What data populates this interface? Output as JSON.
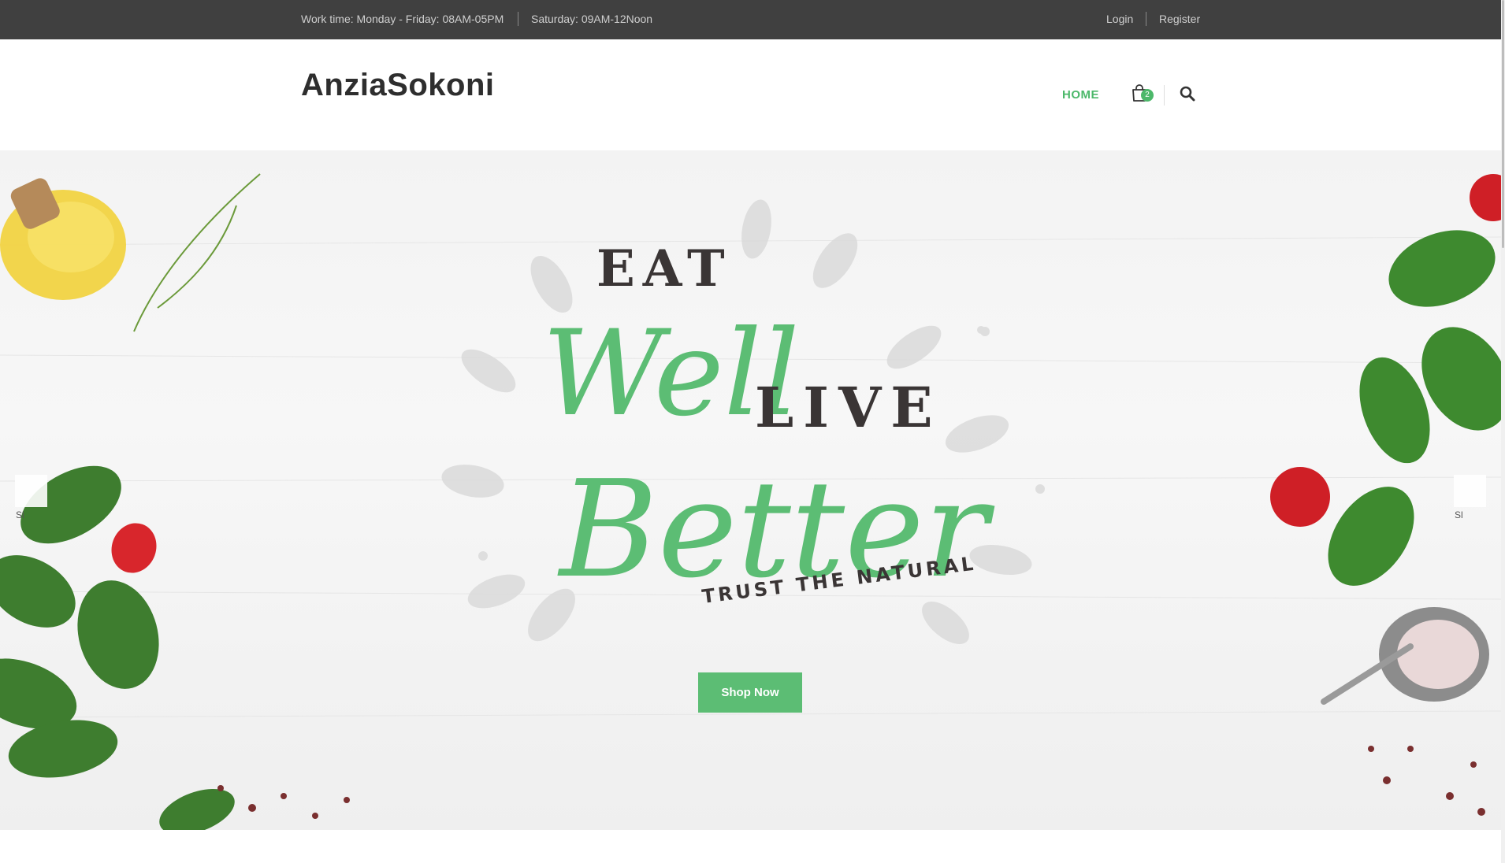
{
  "topbar": {
    "work_time": "Work time: Monday - Friday: 08AM-05PM",
    "saturday": "Saturday: 09AM-12Noon",
    "login": "Login",
    "register": "Register"
  },
  "header": {
    "logo": "AnziaSokoni",
    "nav_home": "HOME",
    "cart_count": "2",
    "accent_color": "#4cb86a"
  },
  "hero": {
    "line_eat": "EAT",
    "line_well": "Well",
    "line_live": "LIVE",
    "line_better": "Better",
    "line_trust": "TRUST THE NATURAL",
    "shop_button": "Shop Now",
    "slide_label_left": "Sl",
    "slide_label_right": "Sl",
    "button_color": "#5cbd74"
  },
  "icons": {
    "cart": "shopping-bag-icon",
    "search": "search-icon"
  }
}
